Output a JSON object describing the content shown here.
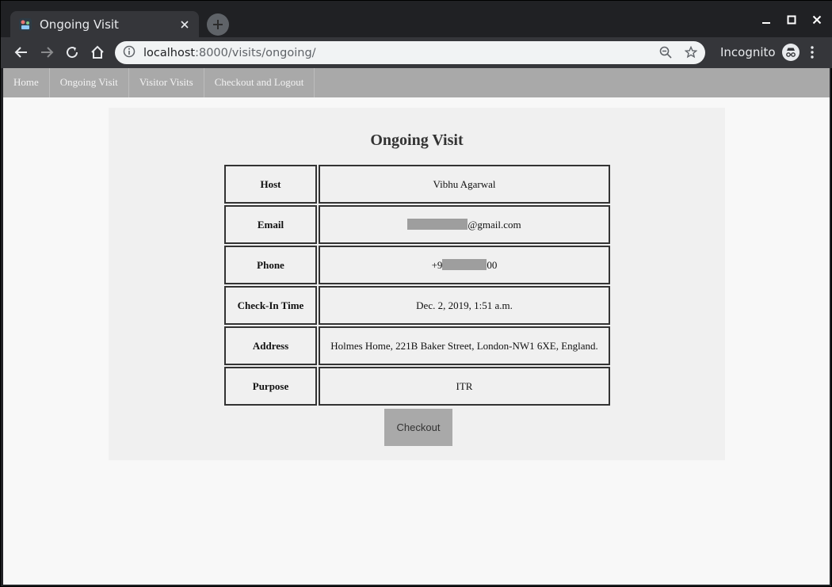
{
  "browser": {
    "tab_title": "Ongoing Visit",
    "url_host": "localhost",
    "url_rest": ":8000/visits/ongoing/",
    "profile_label": "Incognito",
    "icons": {
      "favicon": "app-favicon-icon",
      "close": "close-icon",
      "new_tab": "plus-icon",
      "back": "back-arrow-icon",
      "forward": "forward-arrow-icon",
      "reload": "reload-icon",
      "home": "home-icon",
      "info": "info-icon",
      "zoom": "zoom-out-icon",
      "bookmark": "star-icon",
      "incognito": "incognito-icon",
      "menu": "kebab-menu-icon",
      "minimize": "minimize-icon",
      "maximize": "maximize-icon",
      "window_close": "window-close-icon"
    }
  },
  "nav": {
    "items": [
      {
        "label": "Home"
      },
      {
        "label": "Ongoing Visit"
      },
      {
        "label": "Visitor Visits"
      },
      {
        "label": "Checkout and Logout"
      }
    ]
  },
  "page": {
    "title": "Ongoing Visit",
    "rows": [
      {
        "key": "Host",
        "value": "Vibhu Agarwal"
      },
      {
        "key": "Email",
        "value_suffix": "@gmail.com"
      },
      {
        "key": "Phone",
        "value_prefix": "+9",
        "value_suffix": "00"
      },
      {
        "key": "Check-In Time",
        "value": "Dec. 2, 2019, 1:51 a.m."
      },
      {
        "key": "Address",
        "value": "Holmes Home, 221B Baker Street, London-NW1 6XE, England."
      },
      {
        "key": "Purpose",
        "value": "ITR"
      }
    ],
    "checkout_label": "Checkout"
  },
  "colors": {
    "nav_bg": "#a9a9a9",
    "card_bg": "#f0f0f0",
    "page_bg": "#f8f8f8",
    "button_bg": "#a9a9a9",
    "redaction": "#9e9e9e"
  }
}
